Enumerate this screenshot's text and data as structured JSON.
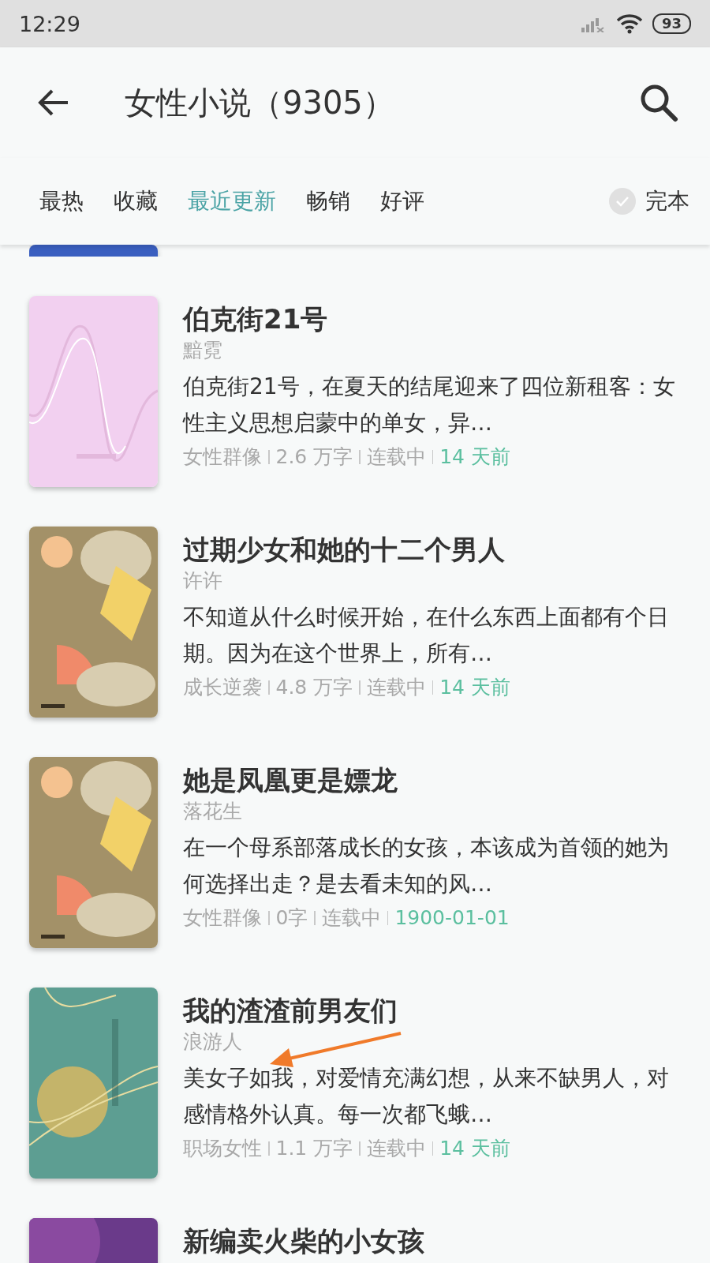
{
  "status_bar": {
    "time": "12:29",
    "battery": "93"
  },
  "header": {
    "title": "女性小说（9305）"
  },
  "tabs": [
    {
      "label": "最热",
      "selected": false
    },
    {
      "label": "收藏",
      "selected": false
    },
    {
      "label": "最近更新",
      "selected": true
    },
    {
      "label": "畅销",
      "selected": false
    },
    {
      "label": "好评",
      "selected": false
    }
  ],
  "finished_filter": {
    "label": "完本",
    "checked": false
  },
  "books": [
    {
      "kind": "partial"
    },
    {
      "kind": "full",
      "title": "伯克街21号",
      "author": "黯霓",
      "description": "伯克街21号，在夏天的结尾迎来了四位新租客：女性主义思想启蒙中的单女，异…",
      "genre": "女性群像",
      "words": "2.6 万字",
      "status": "连载中",
      "updated": "14 天前"
    },
    {
      "kind": "full",
      "title": "过期少女和她的十二个男人",
      "author": "许许",
      "description": "不知道从什么时候开始，在什么东西上面都有个日期。因为在这个世界上，所有…",
      "genre": "成长逆袭",
      "words": "4.8 万字",
      "status": "连载中",
      "updated": "14 天前"
    },
    {
      "kind": "full",
      "title": "她是凤凰更是嫖龙",
      "author": "落花生",
      "description": "在一个母系部落成长的女孩，本该成为首领的她为何选择出走？是去看未知的风…",
      "genre": "女性群像",
      "words": "0字",
      "status": "连载中",
      "updated": "1900-01-01"
    },
    {
      "kind": "full",
      "title": "我的渣渣前男友们",
      "author": "浪游人",
      "description": "美女子如我，对爱情充满幻想，从来不缺男人，对感情格外认真。每一次都飞蛾…",
      "genre": "职场女性",
      "words": "1.1 万字",
      "status": "连载中",
      "updated": "14 天前"
    },
    {
      "kind": "cut",
      "title": "新编卖火柴的小女孩"
    }
  ]
}
